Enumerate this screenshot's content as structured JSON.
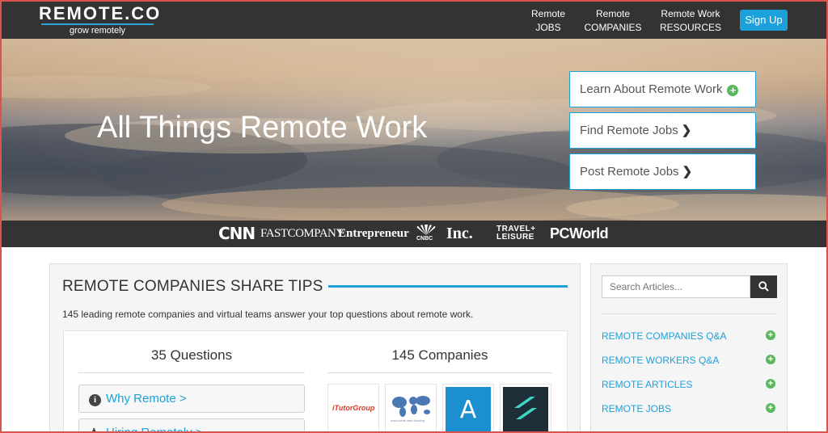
{
  "header": {
    "logo_word": "REMOTE.CO",
    "logo_tagline": "grow remotely",
    "nav": [
      {
        "line1": "Remote",
        "line2": "JOBS"
      },
      {
        "line1": "Remote",
        "line2": "COMPANIES"
      },
      {
        "line1": "Remote Work",
        "line2": "RESOURCES"
      }
    ],
    "signup_label": "Sign Up"
  },
  "hero": {
    "title": "All Things Remote Work",
    "buttons": [
      {
        "label": "Learn About Remote Work",
        "icon": "plus-circle-icon"
      },
      {
        "label": "Find Remote Jobs",
        "icon": "chevron-right-icon"
      },
      {
        "label": "Post Remote Jobs",
        "icon": "chevron-right-icon"
      }
    ]
  },
  "press": {
    "logos": {
      "cnn": "CNN",
      "fast_company": "FASTCOMPANY",
      "entrepreneur": "Entrepreneur",
      "cnbc": "CNBC",
      "inc": "Inc.",
      "travel_leisure_1": "TRAVEL+",
      "travel_leisure_2": "LEISURE",
      "pcworld": "PCWorld"
    }
  },
  "tips": {
    "title": "REMOTE COMPANIES SHARE TIPS",
    "description": "145 leading remote companies and virtual teams answer your top questions about remote work.",
    "questions_heading": "35 Questions",
    "companies_heading": "145 Companies",
    "questions": [
      {
        "label": "Why Remote >",
        "icon": "info-icon"
      },
      {
        "label": "Hiring Remotely >",
        "icon": "person-icon"
      }
    ],
    "company_logos": [
      {
        "name": "iTutorGroup",
        "caption": "iTutorGroup"
      },
      {
        "name": "world-map-company",
        "caption": "world wide web thinking"
      },
      {
        "name": "a-logo-company",
        "caption": "A"
      },
      {
        "name": "s-logo-company",
        "caption": ""
      }
    ]
  },
  "sidebar": {
    "search_placeholder": "Search Articles...",
    "links": [
      {
        "label": "REMOTE COMPANIES Q&A"
      },
      {
        "label": "REMOTE WORKERS Q&A"
      },
      {
        "label": "REMOTE ARTICLES"
      },
      {
        "label": "REMOTE JOBS"
      }
    ]
  },
  "colors": {
    "dark_bar": "#333333",
    "accent_blue": "#1da1db",
    "plus_green": "#5cb85c"
  }
}
